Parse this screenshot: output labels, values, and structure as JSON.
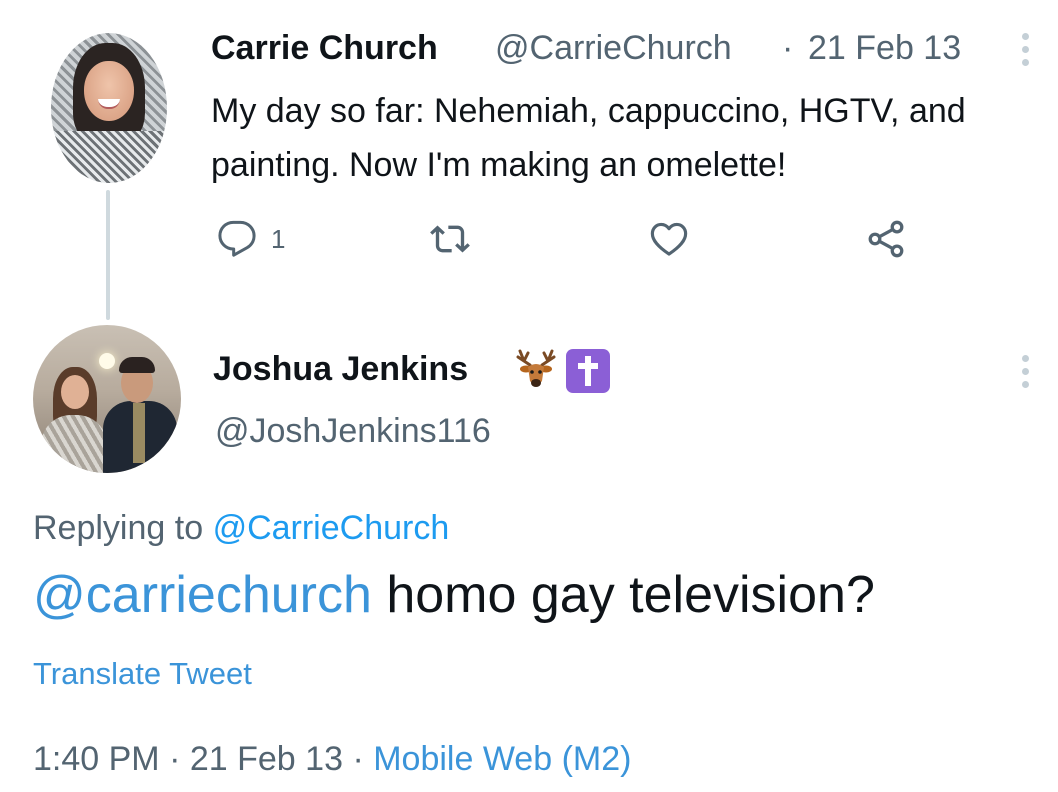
{
  "parent_tweet": {
    "author_name": "Carrie Church",
    "author_handle": "@CarrieChurch",
    "separator": "·",
    "date": "21 Feb 13",
    "text": "My day so far: Nehemiah, cappuccino, HGTV, and painting. Now I'm making an omelette!",
    "reply_count": "1"
  },
  "reply_tweet": {
    "author_name": "Joshua Jenkins",
    "author_handle": "@JoshJenkins116",
    "name_emojis": [
      "deer-emoji",
      "latin-cross-emoji"
    ],
    "replying_prefix": "Replying to",
    "replying_to": "@CarrieChurch",
    "mention": "@carriechurch",
    "text": "homo gay television?",
    "translate_label": "Translate Tweet",
    "time": "1:40 PM",
    "meta_sep": "·",
    "date": "21 Feb 13",
    "source": "Mobile Web (M2)"
  },
  "colors": {
    "text": "#0f1419",
    "secondary": "#536471",
    "link": "#3b94d9",
    "thread_line": "#cfd9de",
    "cross_emoji_bg": "#8b5fd6"
  }
}
